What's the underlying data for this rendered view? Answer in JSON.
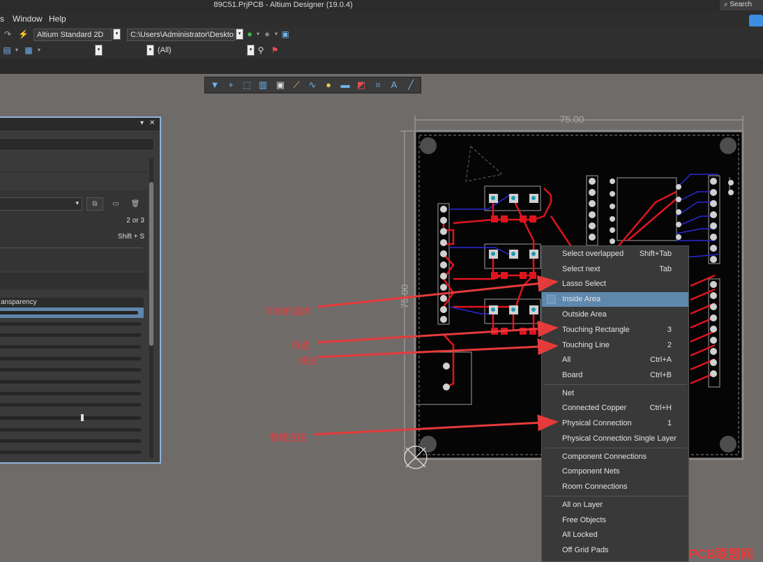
{
  "window": {
    "title": "89C51.PrjPCB - Altium Designer (19.0.4)",
    "search_label": "Search"
  },
  "menu": {
    "items": [
      "s",
      "Window",
      "Help"
    ]
  },
  "toolbar": {
    "view_mode": "Altium Standard 2D",
    "path": "C:\\Users\\Administrator\\Deskto",
    "filter_value": "(All)"
  },
  "panel": {
    "value_shortcut_1": "2 or 3",
    "value_shortcut_2": "Shift + S",
    "column_header": "ansparency"
  },
  "board": {
    "dimension_horizontal": "75.00",
    "dimension_vertical": "75.00"
  },
  "context_menu": {
    "items": [
      {
        "label": "Select overlapped",
        "shortcut": "Shift+Tab"
      },
      {
        "label": "Select next",
        "shortcut": "Tab"
      },
      {
        "label": "Lasso Select",
        "shortcut": ""
      },
      {
        "label": "Inside Area",
        "shortcut": ""
      },
      {
        "label": "Outside Area",
        "shortcut": ""
      },
      {
        "label": "Touching Rectangle",
        "shortcut": "3"
      },
      {
        "label": "Touching Line",
        "shortcut": "2"
      },
      {
        "label": "All",
        "shortcut": "Ctrl+A"
      },
      {
        "label": "Board",
        "shortcut": "Ctrl+B"
      },
      {
        "label": "Net",
        "shortcut": ""
      },
      {
        "label": "Connected Copper",
        "shortcut": "Ctrl+H"
      },
      {
        "label": "Physical Connection",
        "shortcut": "1"
      },
      {
        "label": "Physical Connection Single Layer",
        "shortcut": ""
      },
      {
        "label": "Component Connections",
        "shortcut": ""
      },
      {
        "label": "Component Nets",
        "shortcut": ""
      },
      {
        "label": "Room Connections",
        "shortcut": ""
      },
      {
        "label": "All on Layer",
        "shortcut": ""
      },
      {
        "label": "Free Objects",
        "shortcut": ""
      },
      {
        "label": "All Locked",
        "shortcut": ""
      },
      {
        "label": "Off Grid Pads",
        "shortcut": ""
      }
    ]
  },
  "annotations": {
    "lasso": "手绘的选择",
    "rectangle": "框选",
    "line": "线选",
    "physical": "物理连接"
  },
  "watermark": "PCB联盟网",
  "colors": {
    "arrow": "#e63b3b",
    "highlight": "#5f88ad",
    "trace_red": "#e0141e",
    "trace_blue": "#2a2ad6"
  }
}
